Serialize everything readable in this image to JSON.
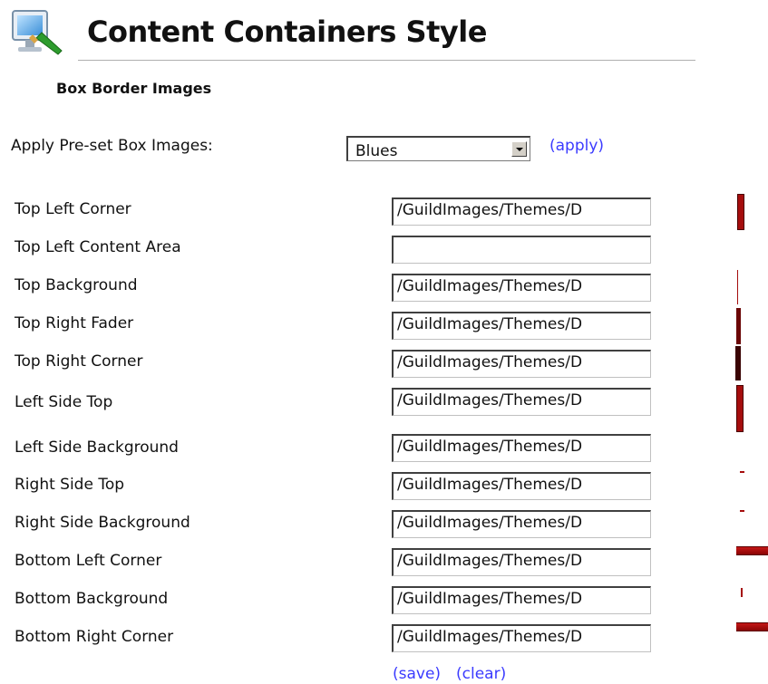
{
  "page": {
    "title": "Content Containers Style",
    "title_icon": "monitor-brush-icon",
    "section_heading": "Box Border Images"
  },
  "preset": {
    "label": "Apply Pre-set Box Images:",
    "selected": "Blues",
    "apply_label": "(apply)"
  },
  "rows": [
    {
      "label": "Top Left Corner",
      "value": "/GuildImages/Themes/D"
    },
    {
      "label": "Top Left Content Area",
      "value": ""
    },
    {
      "label": "Top Background",
      "value": "/GuildImages/Themes/D"
    },
    {
      "label": "Top Right Fader",
      "value": "/GuildImages/Themes/D"
    },
    {
      "label": "Top Right Corner",
      "value": "/GuildImages/Themes/D"
    },
    {
      "label": "Left Side Top",
      "value": "/GuildImages/Themes/D"
    },
    {
      "label": "Left Side Background",
      "value": "/GuildImages/Themes/D"
    },
    {
      "label": "Right Side Top",
      "value": "/GuildImages/Themes/D"
    },
    {
      "label": "Right Side Background",
      "value": "/GuildImages/Themes/D"
    },
    {
      "label": "Bottom Left Corner",
      "value": "/GuildImages/Themes/D"
    },
    {
      "label": "Bottom Background",
      "value": "/GuildImages/Themes/D"
    },
    {
      "label": "Bottom Right Corner",
      "value": "/GuildImages/Themes/D"
    }
  ],
  "actions": {
    "save_label": "(save)",
    "clear_label": "(clear)"
  },
  "colors": {
    "link": "#3b3bff",
    "preview_red": "#a50d0d"
  }
}
